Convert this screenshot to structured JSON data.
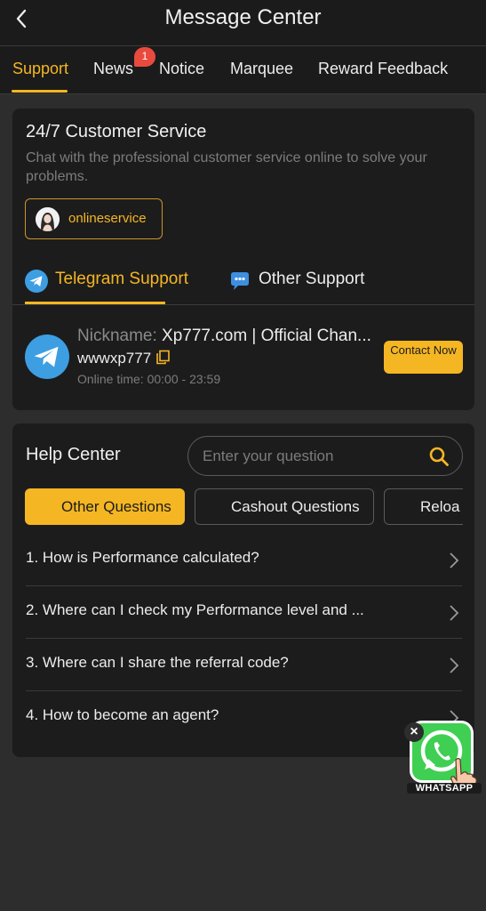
{
  "header": {
    "title": "Message Center",
    "back_icon": "chevron-left-icon"
  },
  "tabs": [
    {
      "label": "Support",
      "active": true
    },
    {
      "label": "News",
      "badge": "1"
    },
    {
      "label": "Notice"
    },
    {
      "label": "Marquee"
    },
    {
      "label": "Reward Feedback"
    }
  ],
  "customer_service": {
    "title": "24/7 Customer Service",
    "description": "Chat with the professional customer service online to solve your problems.",
    "online_button": "onlineservice",
    "support_tabs": [
      {
        "label": "Telegram Support",
        "icon": "telegram-icon",
        "active": true
      },
      {
        "label": "Other Support",
        "icon": "chat-bubble-icon"
      }
    ],
    "contact": {
      "nickname_label": "Nickname:",
      "nickname": "Xp777.com | Official Chan...",
      "handle": "wwwxp777",
      "online_time_label": "Online time:",
      "online_time": "00:00 - 23:59",
      "contact_button": "Contact Now"
    }
  },
  "help_center": {
    "title": "Help Center",
    "search_placeholder": "Enter your question",
    "question_tabs": [
      {
        "label": "Other Questions",
        "active": true
      },
      {
        "label": "Cashout Questions"
      },
      {
        "label": "Reloa"
      }
    ],
    "questions": [
      "1. How is Performance calculated?",
      "2. Where can I check my Performance level and ...",
      "3. Where can I share the referral code?",
      "4. How to become an agent?"
    ]
  },
  "floating": {
    "label": "WHATSAPP",
    "close": "×"
  },
  "colors": {
    "accent": "#f5b623",
    "background": "#2d2d2d",
    "card": "#1c1c1c",
    "badge": "#e84a3e"
  }
}
